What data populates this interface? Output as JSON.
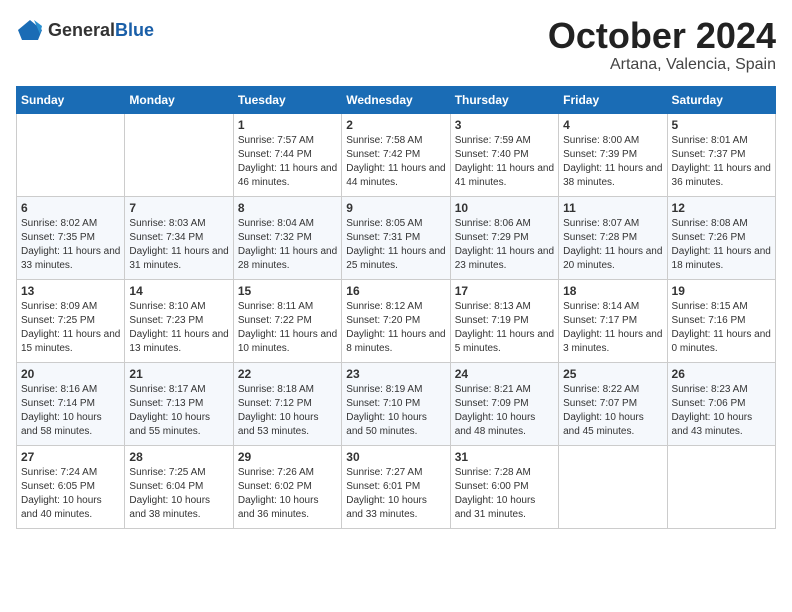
{
  "logo": {
    "general": "General",
    "blue": "Blue"
  },
  "header": {
    "month": "October 2024",
    "location": "Artana, Valencia, Spain"
  },
  "weekdays": [
    "Sunday",
    "Monday",
    "Tuesday",
    "Wednesday",
    "Thursday",
    "Friday",
    "Saturday"
  ],
  "weeks": [
    [
      {
        "day": "",
        "info": ""
      },
      {
        "day": "",
        "info": ""
      },
      {
        "day": "1",
        "info": "Sunrise: 7:57 AM\nSunset: 7:44 PM\nDaylight: 11 hours and 46 minutes."
      },
      {
        "day": "2",
        "info": "Sunrise: 7:58 AM\nSunset: 7:42 PM\nDaylight: 11 hours and 44 minutes."
      },
      {
        "day": "3",
        "info": "Sunrise: 7:59 AM\nSunset: 7:40 PM\nDaylight: 11 hours and 41 minutes."
      },
      {
        "day": "4",
        "info": "Sunrise: 8:00 AM\nSunset: 7:39 PM\nDaylight: 11 hours and 38 minutes."
      },
      {
        "day": "5",
        "info": "Sunrise: 8:01 AM\nSunset: 7:37 PM\nDaylight: 11 hours and 36 minutes."
      }
    ],
    [
      {
        "day": "6",
        "info": "Sunrise: 8:02 AM\nSunset: 7:35 PM\nDaylight: 11 hours and 33 minutes."
      },
      {
        "day": "7",
        "info": "Sunrise: 8:03 AM\nSunset: 7:34 PM\nDaylight: 11 hours and 31 minutes."
      },
      {
        "day": "8",
        "info": "Sunrise: 8:04 AM\nSunset: 7:32 PM\nDaylight: 11 hours and 28 minutes."
      },
      {
        "day": "9",
        "info": "Sunrise: 8:05 AM\nSunset: 7:31 PM\nDaylight: 11 hours and 25 minutes."
      },
      {
        "day": "10",
        "info": "Sunrise: 8:06 AM\nSunset: 7:29 PM\nDaylight: 11 hours and 23 minutes."
      },
      {
        "day": "11",
        "info": "Sunrise: 8:07 AM\nSunset: 7:28 PM\nDaylight: 11 hours and 20 minutes."
      },
      {
        "day": "12",
        "info": "Sunrise: 8:08 AM\nSunset: 7:26 PM\nDaylight: 11 hours and 18 minutes."
      }
    ],
    [
      {
        "day": "13",
        "info": "Sunrise: 8:09 AM\nSunset: 7:25 PM\nDaylight: 11 hours and 15 minutes."
      },
      {
        "day": "14",
        "info": "Sunrise: 8:10 AM\nSunset: 7:23 PM\nDaylight: 11 hours and 13 minutes."
      },
      {
        "day": "15",
        "info": "Sunrise: 8:11 AM\nSunset: 7:22 PM\nDaylight: 11 hours and 10 minutes."
      },
      {
        "day": "16",
        "info": "Sunrise: 8:12 AM\nSunset: 7:20 PM\nDaylight: 11 hours and 8 minutes."
      },
      {
        "day": "17",
        "info": "Sunrise: 8:13 AM\nSunset: 7:19 PM\nDaylight: 11 hours and 5 minutes."
      },
      {
        "day": "18",
        "info": "Sunrise: 8:14 AM\nSunset: 7:17 PM\nDaylight: 11 hours and 3 minutes."
      },
      {
        "day": "19",
        "info": "Sunrise: 8:15 AM\nSunset: 7:16 PM\nDaylight: 11 hours and 0 minutes."
      }
    ],
    [
      {
        "day": "20",
        "info": "Sunrise: 8:16 AM\nSunset: 7:14 PM\nDaylight: 10 hours and 58 minutes."
      },
      {
        "day": "21",
        "info": "Sunrise: 8:17 AM\nSunset: 7:13 PM\nDaylight: 10 hours and 55 minutes."
      },
      {
        "day": "22",
        "info": "Sunrise: 8:18 AM\nSunset: 7:12 PM\nDaylight: 10 hours and 53 minutes."
      },
      {
        "day": "23",
        "info": "Sunrise: 8:19 AM\nSunset: 7:10 PM\nDaylight: 10 hours and 50 minutes."
      },
      {
        "day": "24",
        "info": "Sunrise: 8:21 AM\nSunset: 7:09 PM\nDaylight: 10 hours and 48 minutes."
      },
      {
        "day": "25",
        "info": "Sunrise: 8:22 AM\nSunset: 7:07 PM\nDaylight: 10 hours and 45 minutes."
      },
      {
        "day": "26",
        "info": "Sunrise: 8:23 AM\nSunset: 7:06 PM\nDaylight: 10 hours and 43 minutes."
      }
    ],
    [
      {
        "day": "27",
        "info": "Sunrise: 7:24 AM\nSunset: 6:05 PM\nDaylight: 10 hours and 40 minutes."
      },
      {
        "day": "28",
        "info": "Sunrise: 7:25 AM\nSunset: 6:04 PM\nDaylight: 10 hours and 38 minutes."
      },
      {
        "day": "29",
        "info": "Sunrise: 7:26 AM\nSunset: 6:02 PM\nDaylight: 10 hours and 36 minutes."
      },
      {
        "day": "30",
        "info": "Sunrise: 7:27 AM\nSunset: 6:01 PM\nDaylight: 10 hours and 33 minutes."
      },
      {
        "day": "31",
        "info": "Sunrise: 7:28 AM\nSunset: 6:00 PM\nDaylight: 10 hours and 31 minutes."
      },
      {
        "day": "",
        "info": ""
      },
      {
        "day": "",
        "info": ""
      }
    ]
  ]
}
